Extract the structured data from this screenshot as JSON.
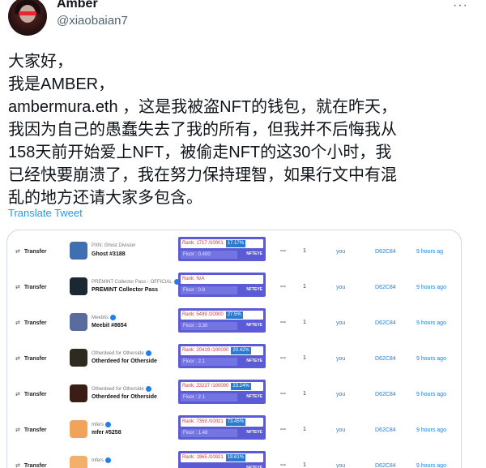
{
  "tweet": {
    "author_name": "Amber",
    "author_handle": "@xiaobaian7",
    "more_glyph": "···",
    "lines": [
      "大家好，",
      "我是AMBER，",
      "ambermura.eth ，这是我被盗NFT的钱包，就在昨天，",
      "我因为自己的愚蠢失去了我的所有，但我并不后悔我从",
      "158天前开始爱上NFT，被偷走NFT的这30个小时，我",
      "已经快要崩溃了，我在努力保持理智，如果行文中有混",
      "乱的地方还请大家多包含。"
    ],
    "translate_label": "Translate Tweet"
  },
  "activity": {
    "widget_brand": "NFTEYE",
    "rows": [
      {
        "event": "Transfer",
        "collection": "PXN: Ghost Division",
        "item": "Ghost #3188",
        "verified": false,
        "rank": "Rank: 1717 /10001",
        "percent": "17.17%",
        "floor": "Floor : 0.400",
        "dots": "---",
        "qty": "1",
        "from": "you",
        "to": "D62C84",
        "time": "9 hours ag",
        "thumb_color": "#3f6fb0"
      },
      {
        "event": "Transfer",
        "collection": "PREMINT Collector Pass - OFFICIAL",
        "item": "PREMINT Collector Pass",
        "verified": true,
        "rank": "Rank: N/A",
        "percent": "",
        "floor": "Floor : 0.8",
        "dots": "---",
        "qty": "1",
        "from": "you",
        "to": "D62C84",
        "time": "9 hours ago",
        "thumb_color": "#1b2733"
      },
      {
        "event": "Transfer",
        "collection": "Meebits",
        "item": "Meebit #8654",
        "verified": true,
        "rank": "Rank: 5499 /20000",
        "percent": "27.5%",
        "floor": "Floor : 3.30",
        "dots": "---",
        "qty": "1",
        "from": "you",
        "to": "D62C84",
        "time": "9 hours ago",
        "thumb_color": "#5a6c9e"
      },
      {
        "event": "Transfer",
        "collection": "Otherdeed for Otherside",
        "item": "Otherdeed for Otherside",
        "verified": true,
        "rank": "Rank: 20419 /100000",
        "percent": "20.42%",
        "floor": "Floor : 2.1",
        "dots": "---",
        "qty": "1",
        "from": "you",
        "to": "D62C84",
        "time": "9 hours ago",
        "thumb_color": "#2e2a1f"
      },
      {
        "event": "Transfer",
        "collection": "Otherdeed for Otherside",
        "item": "Otherdeed for Otherside",
        "verified": true,
        "rank": "Rank: 23237 /100000",
        "percent": "23.24%",
        "floor": "Floor : 2.1",
        "dots": "---",
        "qty": "1",
        "from": "you",
        "to": "D62C84",
        "time": "9 hours ago",
        "thumb_color": "#3a1e16"
      },
      {
        "event": "Transfer",
        "collection": "mfers",
        "item": "mfer #5258",
        "verified": true,
        "rank": "Rank: 7359 /10021",
        "percent": "73.45%",
        "floor": "Floor : 1.48",
        "dots": "---",
        "qty": "1",
        "from": "you",
        "to": "D62C84",
        "time": "9 hours ago",
        "thumb_color": "#f0a45a"
      },
      {
        "event": "Transfer",
        "collection": "mfers",
        "item": "",
        "verified": true,
        "rank": "Rank: 1965 /10021",
        "percent": "19.61%",
        "floor": "",
        "dots": "---",
        "qty": "1",
        "from": "you",
        "to": "D62C84",
        "time": "9 hours ago",
        "thumb_color": "#f3b06a"
      }
    ]
  }
}
